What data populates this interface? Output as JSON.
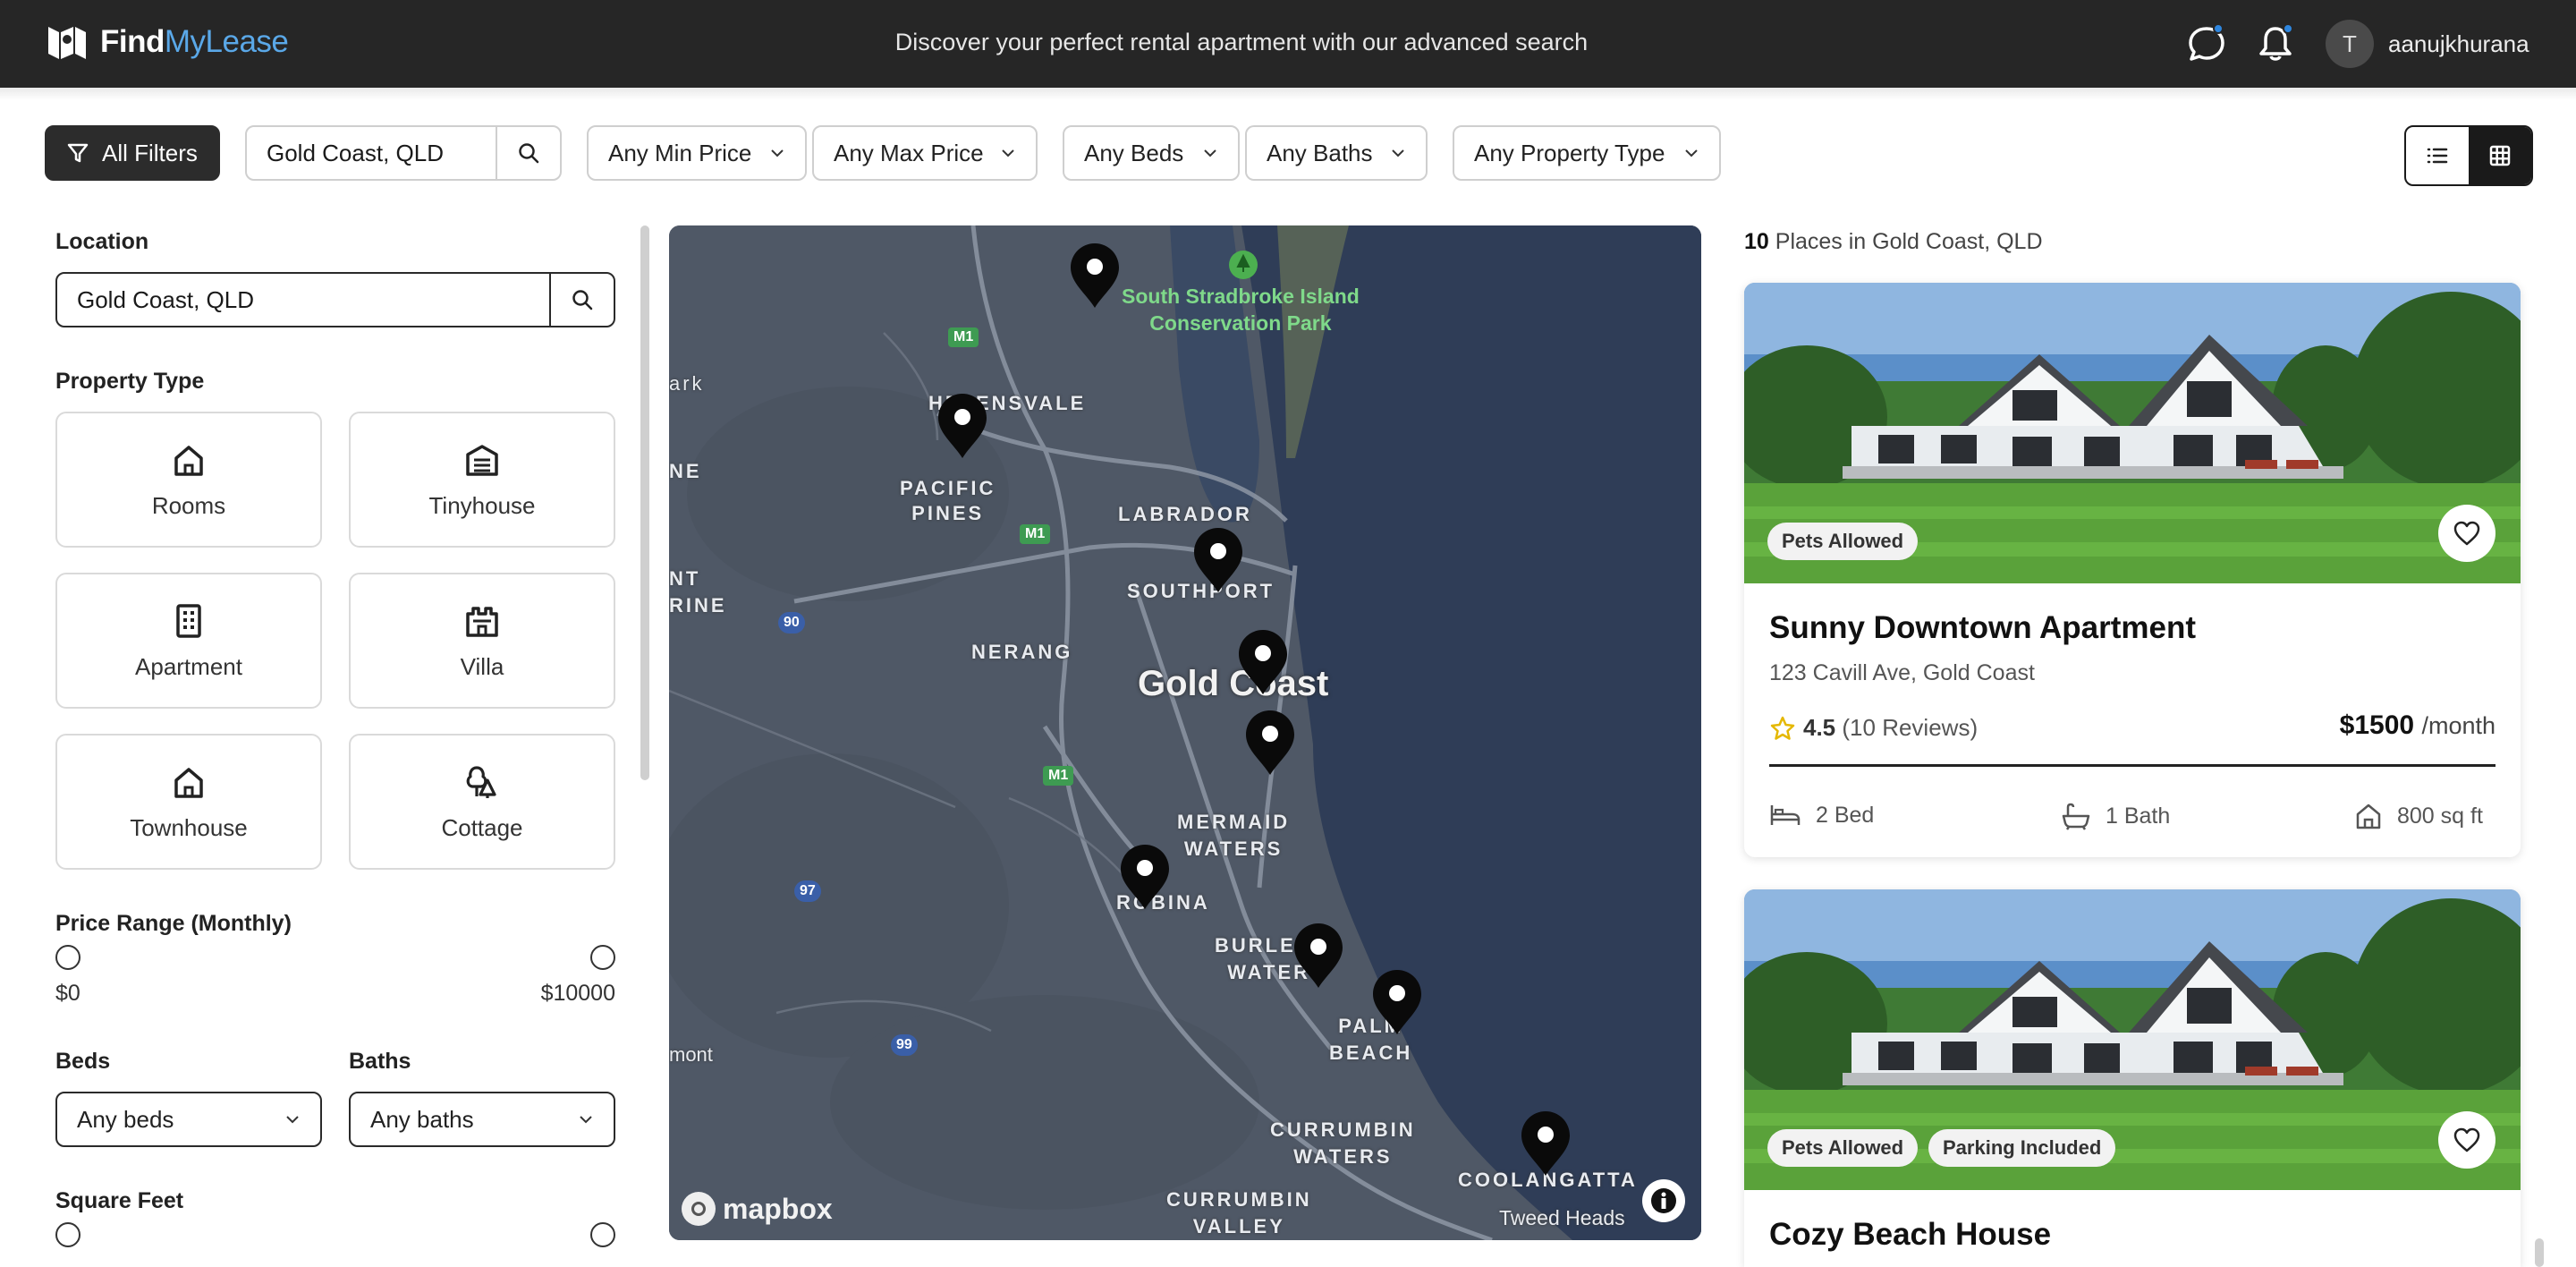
{
  "header": {
    "brand_bold": "Find",
    "brand_light": "MyLease",
    "tagline": "Discover your perfect rental apartment with our advanced search",
    "avatar_initial": "T",
    "username": "aanujkhurana",
    "accent": "#5aa8e8",
    "notification_dot": "#2e86de"
  },
  "filters": {
    "all_filters": "All Filters",
    "search_value": "Gold Coast, QLD",
    "min_price": "Any Min Price",
    "max_price": "Any Max Price",
    "beds": "Any Beds",
    "baths": "Any Baths",
    "property_type": "Any Property Type"
  },
  "sidebar": {
    "location_label": "Location",
    "location_value": "Gold Coast, QLD",
    "property_type_label": "Property Type",
    "types": [
      "Rooms",
      "Tinyhouse",
      "Apartment",
      "Villa",
      "Townhouse",
      "Cottage"
    ],
    "price_label": "Price Range (Monthly)",
    "price_min": "$0",
    "price_max": "$10000",
    "beds_label": "Beds",
    "baths_label": "Baths",
    "beds_value": "Any beds",
    "baths_value": "Any baths",
    "sqft_label": "Square Feet"
  },
  "map": {
    "labels": {
      "park1": "South Stradbroke Island",
      "park2": "Conservation Park",
      "helensvale": "HELENSVALE",
      "pacific": "PACIFIC",
      "pines": "PINES",
      "labrador": "LABRADOR",
      "southport": "SOUTHPORT",
      "nerang": "NERANG",
      "goldcoast": "Gold Coast",
      "mermaid": "MERMAID",
      "waters": "WATERS",
      "robina": "ROBINA",
      "burleigh": "BURLEIGH",
      "burleigh2": "WATERS",
      "palm": "PALM",
      "beach": "BEACH",
      "currumbin": "CURRUMBIN",
      "currumbin2": "WATERS",
      "currumbinv": "CURRUMBIN",
      "valley": "VALLEY",
      "coolangatta": "COOLANGATTA",
      "tweed": "Tweed Heads",
      "ark": "ark",
      "ne": "NE",
      "nt": "NT",
      "rine": "RINE",
      "mont": "mont",
      "m1": "M1",
      "r90": "90",
      "r97": "97",
      "r99": "99",
      "mapbox": "mapbox"
    },
    "water_color": "#2f3d57",
    "land_color": "#4f5866"
  },
  "results": {
    "count": "10",
    "text": "Places in Gold Coast, QLD",
    "listings": [
      {
        "badges": [
          "Pets Allowed"
        ],
        "title": "Sunny Downtown Apartment",
        "address": "123 Cavill Ave, Gold Coast",
        "rating": "4.5",
        "reviews": "(10 Reviews)",
        "price": "$1500",
        "period": "/month",
        "beds": "2 Bed",
        "baths": "1 Bath",
        "area": "800 sq ft"
      },
      {
        "badges": [
          "Pets Allowed",
          "Parking Included"
        ],
        "title": "Cozy Beach House"
      }
    ]
  }
}
